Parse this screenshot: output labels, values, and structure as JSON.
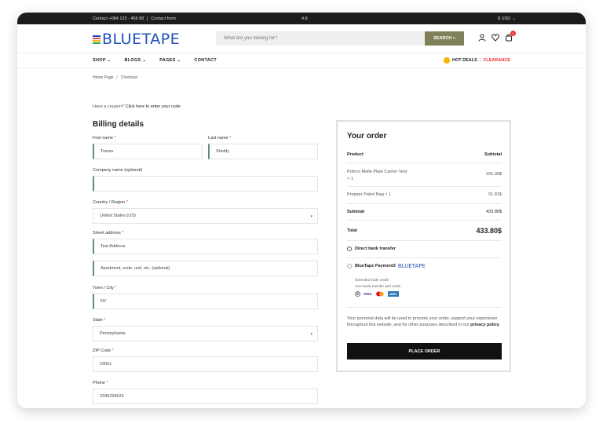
{
  "topbar": {
    "contact_phone": "Contact +084 123 - 456 88",
    "contact_form": "Contact form",
    "center": "4.8",
    "currency": "$ USD",
    "currency_caret": "⌄"
  },
  "header": {
    "logo_text": "BLUETAPE",
    "search_placeholder": "What are you looking for?",
    "search_button": "SEARCH »",
    "cart_count": "0"
  },
  "nav": {
    "items": [
      "SHOP ⌄",
      "BLOGS ⌄",
      "PAGES ⌄",
      "CONTACT"
    ],
    "hot_deals": "HOT DEALS",
    "clearance": "CLEARANCE"
  },
  "breadcrumb": {
    "home": "Home Page",
    "sep": "/",
    "current": "Checkout"
  },
  "coupon": {
    "text": "Have a coupon?",
    "link": "Click here to enter your code"
  },
  "billing": {
    "title": "Billing details",
    "required_mark": "*",
    "first_name": {
      "label": "First name",
      "value": "Tomas"
    },
    "last_name": {
      "label": "Last name",
      "value": "Sheldy"
    },
    "company": {
      "label": "Company name (optional)",
      "value": ""
    },
    "country": {
      "label": "Country / Region",
      "value": "United States (US)"
    },
    "street": {
      "label": "Street address",
      "value": "Test Address",
      "placeholder2": "Apartment, suite, unit, etc. (optional)"
    },
    "town": {
      "label": "Town / City",
      "value": "NY"
    },
    "state": {
      "label": "State",
      "value": "Pennsylvania"
    },
    "zip": {
      "label": "ZIP Code",
      "value": "19051"
    },
    "phone": {
      "label": "Phone",
      "value": "2345234523"
    },
    "select_caret": "▾"
  },
  "order": {
    "title": "Your order",
    "col_product": "Product",
    "col_subtotal": "Subtotal",
    "items": [
      {
        "name": "Pothco Molle Plate Carrier Vest",
        "qty": "× 1",
        "price": "341.99$"
      },
      {
        "name": "Propper Patrol Bag",
        "qty": "× 1",
        "price": "91.81$"
      }
    ],
    "subtotal_label": "Subtotal",
    "subtotal_value": "433.80$",
    "total_label": "Total",
    "total_value": "433.80$",
    "payment_bank": "Direct bank transfer",
    "payment_bluetape": "BlueTape Payment3",
    "payment_logo": "BLUETAPE",
    "payment_desc1": "Extended trade credit",
    "payment_desc2": "ACH bank transfer and cards",
    "cards": [
      "VISA",
      "AMEX"
    ],
    "privacy_text": "Your personal data will be used to process your order, support your experience throughout this website, and for other purposes described in our",
    "privacy_link": "privacy policy",
    "privacy_end": ".",
    "place_order": "PLACE ORDER"
  }
}
